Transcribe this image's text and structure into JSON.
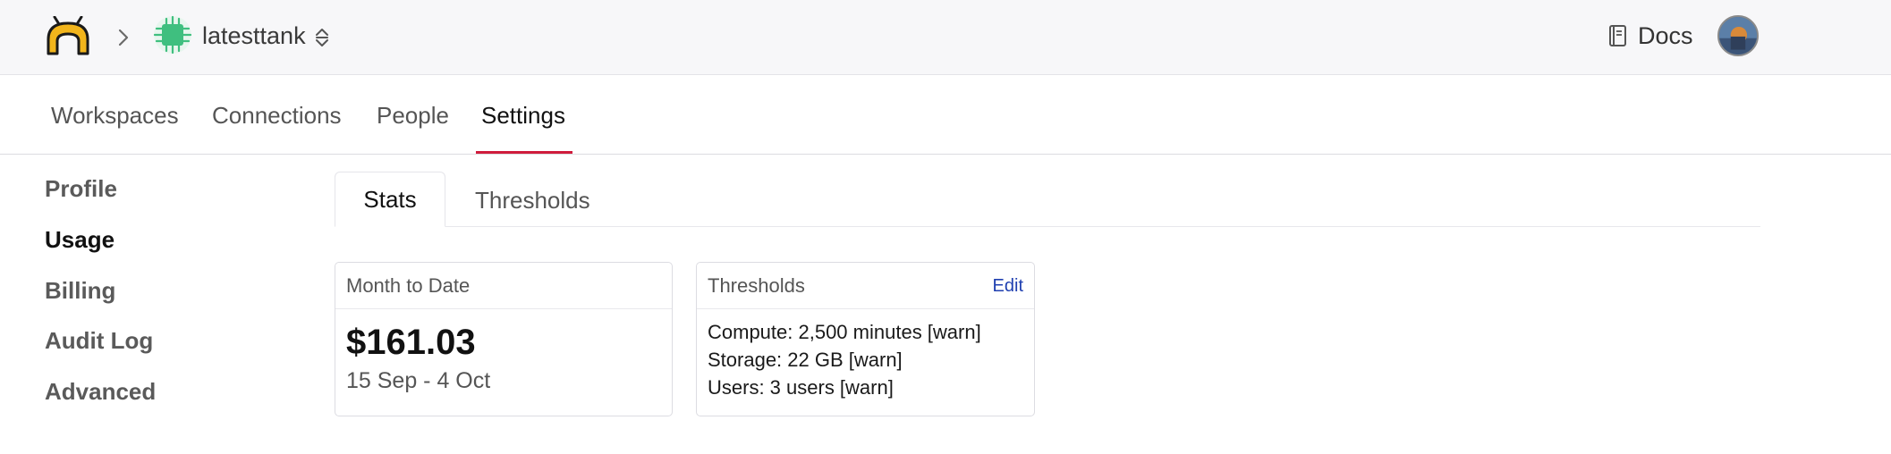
{
  "header": {
    "logo_icon": "bridge-logo-icon",
    "breadcrumb_chevron_icon": "chevron-right-icon",
    "workspace_icon": "chip-icon",
    "workspace_name": "latesttank",
    "switcher_icon": "chevron-updown-icon",
    "docs_label": "Docs",
    "docs_icon": "book-icon",
    "avatar_icon": "user-avatar"
  },
  "nav": {
    "items": [
      {
        "label": "Workspaces"
      },
      {
        "label": "Connections"
      },
      {
        "label": "People"
      },
      {
        "label": "Settings",
        "active": true
      }
    ],
    "accent_color": "#d01c3c"
  },
  "sidebar": {
    "items": [
      {
        "label": "Profile"
      },
      {
        "label": "Usage",
        "active": true
      },
      {
        "label": "Billing"
      },
      {
        "label": "Audit Log"
      },
      {
        "label": "Advanced"
      }
    ]
  },
  "tabs": [
    {
      "label": "Stats",
      "active": true
    },
    {
      "label": "Thresholds"
    }
  ],
  "month_to_date": {
    "title": "Month to Date",
    "amount": "$161.03",
    "date_range": "15 Sep - 4 Oct"
  },
  "thresholds": {
    "title": "Thresholds",
    "edit_label": "Edit",
    "lines": [
      "Compute: 2,500 minutes [warn]",
      "Storage: 22 GB [warn]",
      "Users: 3 users [warn]"
    ],
    "link_color": "#1f3fb0"
  }
}
